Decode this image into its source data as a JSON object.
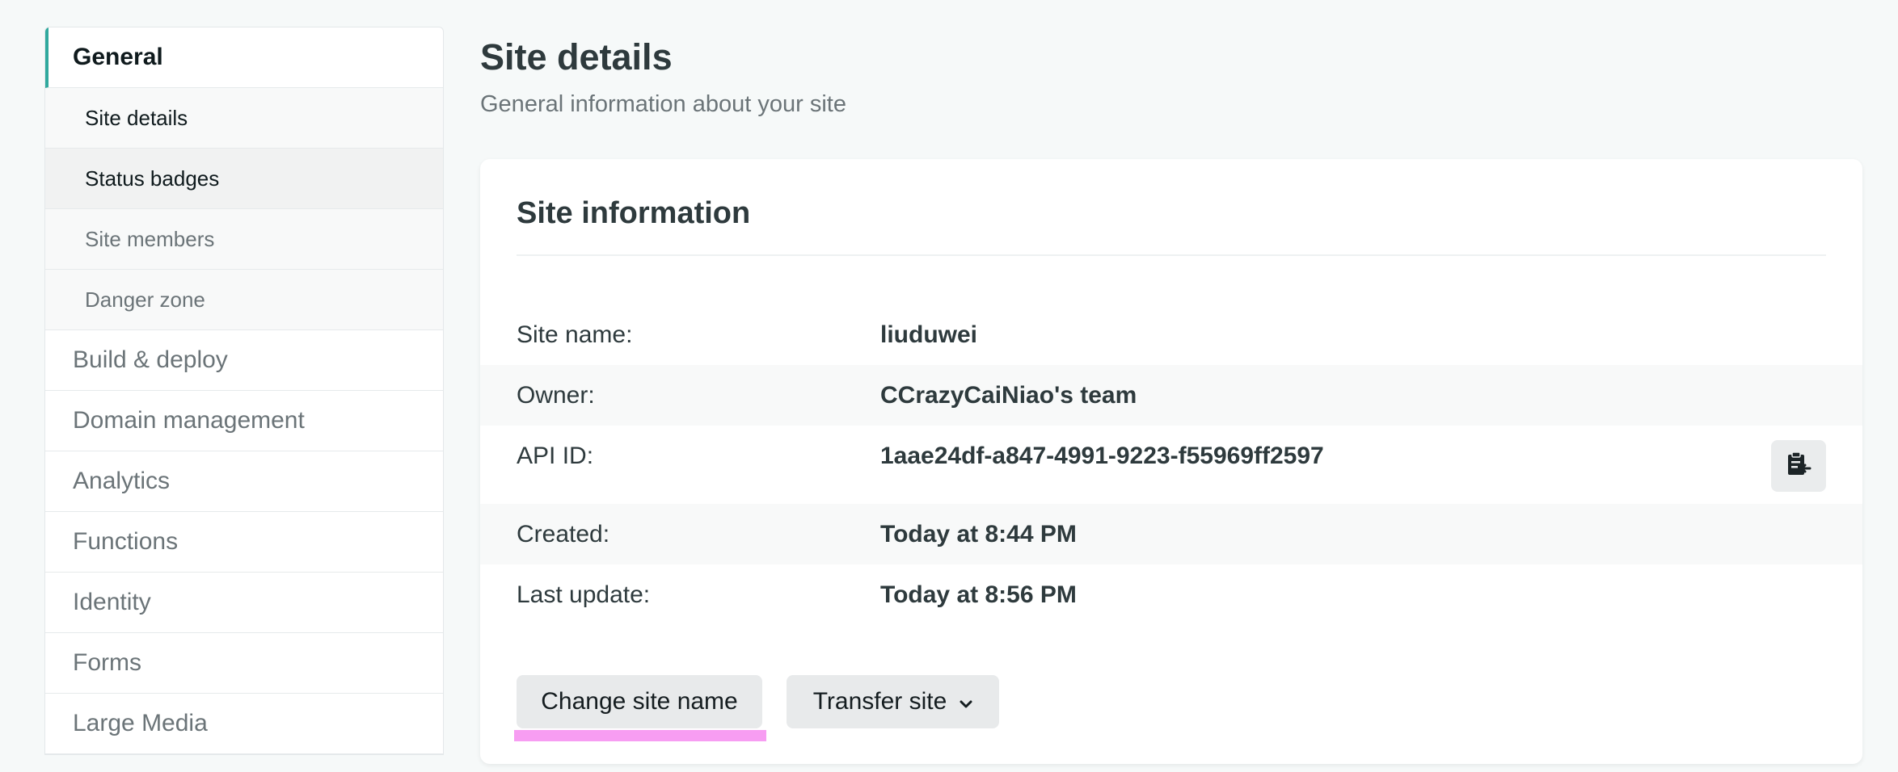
{
  "sidebar": {
    "general": "General",
    "sub_items": [
      {
        "label": "Site details"
      },
      {
        "label": "Status badges"
      },
      {
        "label": "Site members"
      },
      {
        "label": "Danger zone"
      }
    ],
    "items": [
      {
        "label": "Build & deploy"
      },
      {
        "label": "Domain management"
      },
      {
        "label": "Analytics"
      },
      {
        "label": "Functions"
      },
      {
        "label": "Identity"
      },
      {
        "label": "Forms"
      },
      {
        "label": "Large Media"
      }
    ]
  },
  "page": {
    "title": "Site details",
    "subtitle": "General information about your site"
  },
  "card": {
    "title": "Site information",
    "rows": [
      {
        "label": "Site name:",
        "value": "liuduwei"
      },
      {
        "label": "Owner:",
        "value": "CCrazyCaiNiao's team"
      },
      {
        "label": "API ID:",
        "value": "1aae24df-a847-4991-9223-f55969ff2597"
      },
      {
        "label": "Created:",
        "value": "Today at 8:44 PM"
      },
      {
        "label": "Last update:",
        "value": "Today at 8:56 PM"
      }
    ],
    "copy_icon": "clipboard-icon",
    "change_site_name_button": "Change site name",
    "transfer_site_button": "Transfer site",
    "transfer_chevron_icon": "chevron-down-icon"
  },
  "colors": {
    "accent": "#30a99e",
    "highlight": "#f79df2"
  }
}
